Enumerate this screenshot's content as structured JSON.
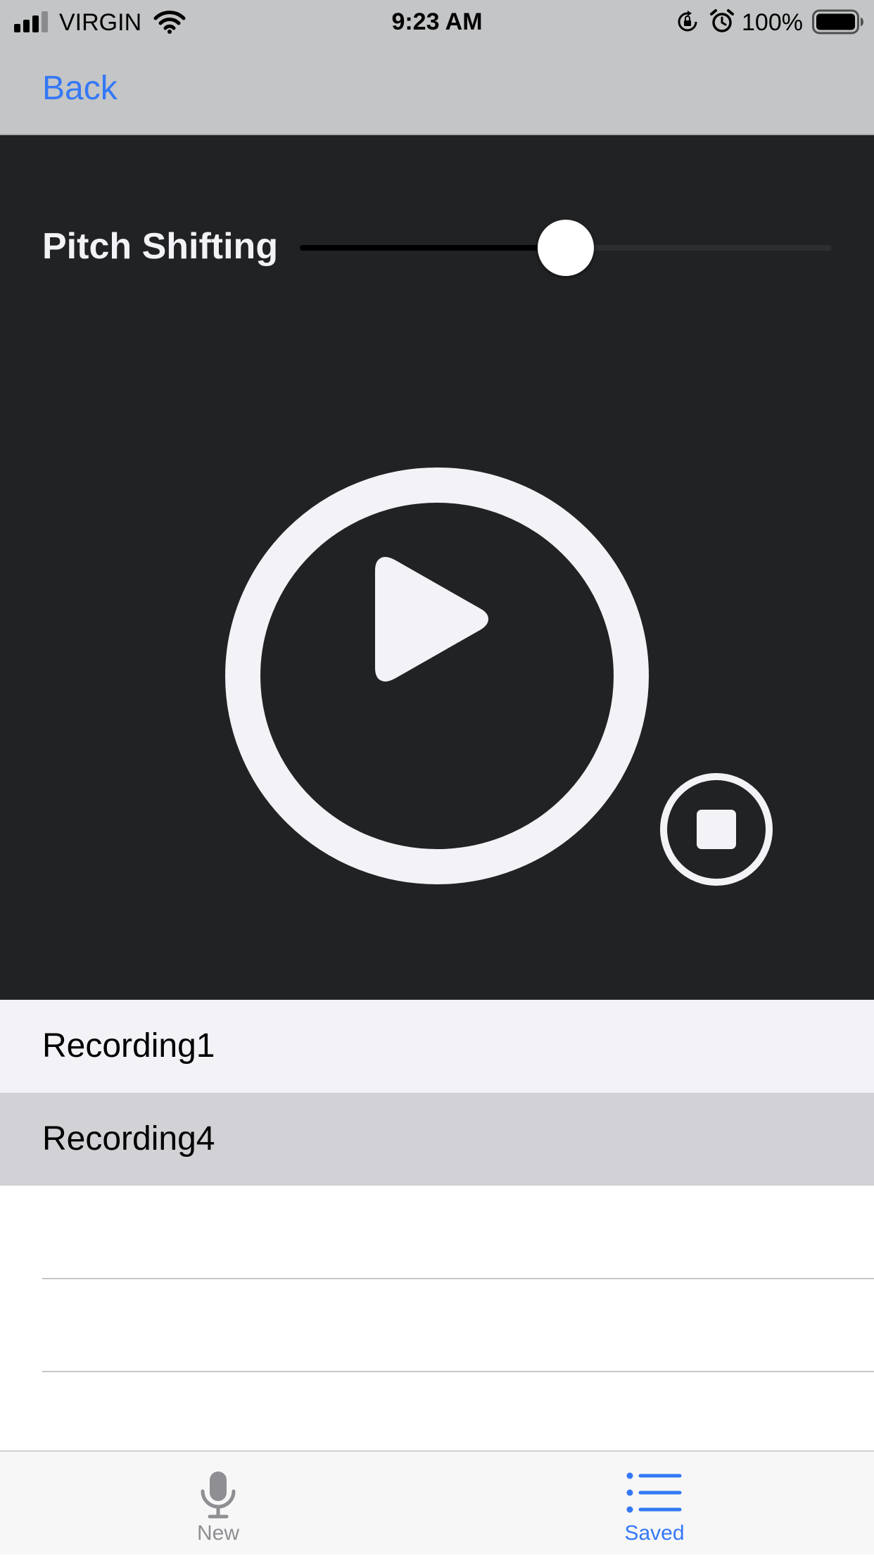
{
  "status_bar": {
    "carrier": "VIRGIN",
    "time": "9:23 AM",
    "battery_percent": "100%",
    "icons": [
      "signal-icon",
      "wifi-icon",
      "lock-rotation-icon",
      "alarm-icon",
      "battery-icon"
    ]
  },
  "nav": {
    "back_label": "Back"
  },
  "player": {
    "pitch_label": "Pitch Shifting",
    "pitch_value": 0.5,
    "play_icon": "play-icon",
    "stop_icon": "stop-icon"
  },
  "recordings": {
    "items": [
      {
        "label": "Recording1",
        "selected": false
      },
      {
        "label": "Recording4",
        "selected": true
      }
    ]
  },
  "tab_bar": {
    "tabs": [
      {
        "label": "New",
        "icon": "microphone-icon",
        "active": false
      },
      {
        "label": "Saved",
        "icon": "list-icon",
        "active": true
      }
    ]
  },
  "colors": {
    "accent": "#3478f6",
    "player_background": "#212224",
    "bar_background": "#c4c5c6",
    "control_fill": "#f2f2f7",
    "inactive_tab": "#8e8e93",
    "selected_row": "#d1d1d6"
  }
}
